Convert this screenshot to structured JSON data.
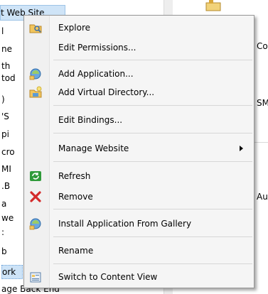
{
  "tree": {
    "header_text": "t Web Site",
    "lines": [
      "l",
      "ne",
      "th",
      "tod",
      ")",
      "'S",
      "pi",
      "cro",
      "MI",
      ".B",
      "a",
      "we",
      ":",
      "b",
      "ork",
      "age Back End"
    ],
    "selected_index": 14
  },
  "right_panel": {
    "labels": [
      "Co",
      "SM",
      "Au"
    ]
  },
  "menu": {
    "items": [
      {
        "label": "Explore",
        "icon": "explore-folder-icon"
      },
      {
        "label": "Edit Permissions...",
        "icon": ""
      },
      {
        "label": "Add Application...",
        "icon": "add-application-icon"
      },
      {
        "label": "Add Virtual Directory...",
        "icon": "add-virtual-directory-icon"
      },
      {
        "label": "Edit Bindings...",
        "icon": ""
      },
      {
        "label": "Manage Website",
        "icon": "",
        "submenu": true
      },
      {
        "label": "Refresh",
        "icon": "refresh-icon"
      },
      {
        "label": "Remove",
        "icon": "remove-x-icon"
      },
      {
        "label": "Install Application From Gallery",
        "icon": "install-gallery-icon"
      },
      {
        "label": "Rename",
        "icon": ""
      },
      {
        "label": "Switch to Content View",
        "icon": "content-view-icon"
      }
    ]
  },
  "colors": {
    "menu_bg": "#f5f5f5",
    "selection": "#cde3f7",
    "remove_red": "#d42a2a",
    "refresh_green": "#2f9a3a"
  }
}
